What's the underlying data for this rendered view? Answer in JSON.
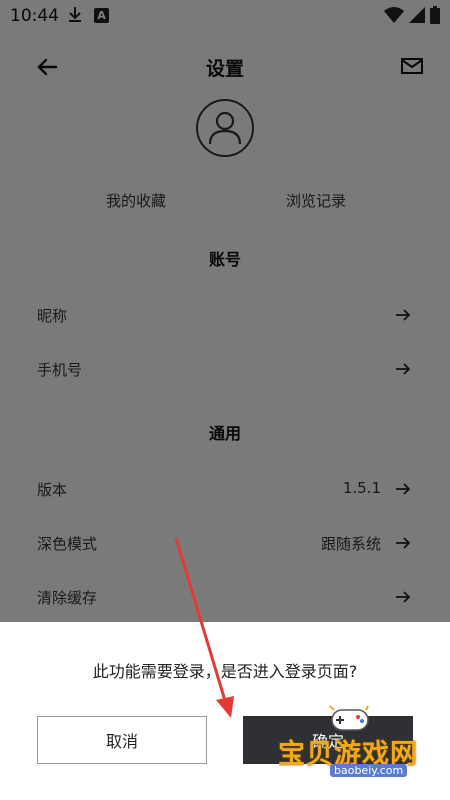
{
  "status_bar": {
    "time": "10:44"
  },
  "header": {
    "title": "设置"
  },
  "quick_links": {
    "favorites": "我的收藏",
    "history": "浏览记录"
  },
  "sections": {
    "account": {
      "title": "账号",
      "rows": [
        {
          "label": "昵称",
          "value": ""
        },
        {
          "label": "手机号",
          "value": ""
        }
      ]
    },
    "general": {
      "title": "通用",
      "rows": [
        {
          "label": "版本",
          "value": "1.5.1"
        },
        {
          "label": "深色模式",
          "value": "跟随系统"
        },
        {
          "label": "清除缓存",
          "value": ""
        }
      ]
    }
  },
  "dialog": {
    "message": "此功能需要登录，是否进入登录页面?",
    "cancel_label": "取消",
    "confirm_label": "确定"
  },
  "watermark": {
    "text": "宝贝游戏网",
    "url": "baobeiy.com"
  },
  "colors": {
    "annotation_arrow": "#e53935",
    "confirm_bg": "#2f3033",
    "watermark": "#f2a818"
  }
}
